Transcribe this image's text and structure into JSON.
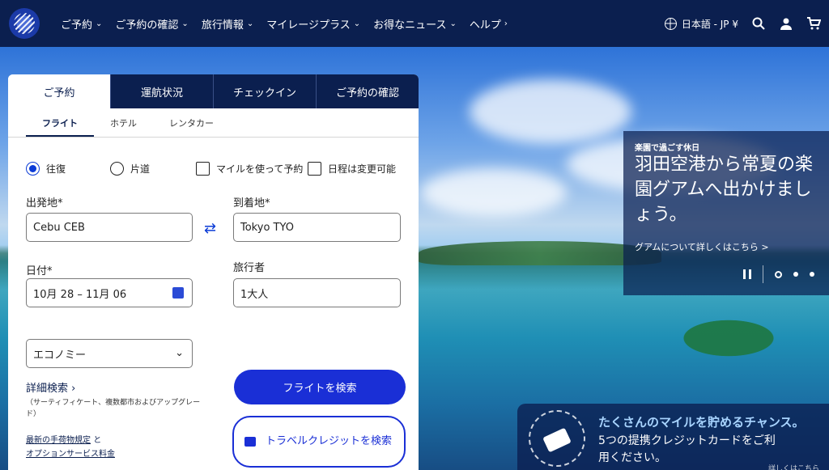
{
  "header": {
    "logo_icon": "globe-logo-icon",
    "nav": [
      {
        "label": "ご予約",
        "has_dropdown": true
      },
      {
        "label": "ご予約の確認",
        "has_dropdown": true
      },
      {
        "label": "旅行情報",
        "has_dropdown": true
      },
      {
        "label": "マイレージプラス",
        "has_dropdown": true
      },
      {
        "label": "お得なニュース",
        "has_dropdown": true
      },
      {
        "label": "ヘルプ",
        "has_dropdown": false
      }
    ],
    "language": "日本語 - JP ¥",
    "icons": [
      "globe-icon",
      "search-icon",
      "user-icon",
      "cart-icon"
    ]
  },
  "booking": {
    "main_tabs": [
      "ご予約",
      "運航状況",
      "チェックイン",
      "ご予約の確認"
    ],
    "active_main_tab": 0,
    "sub_tabs": [
      "フライト",
      "ホテル",
      "レンタカー"
    ],
    "active_sub_tab": 0,
    "trip_types": {
      "roundtrip": "往復",
      "oneway": "片道",
      "use_miles": "マイルを使って予約",
      "flexible_dates": "日程は変更可能"
    },
    "from_label": "出発地*",
    "from_value": "Cebu CEB",
    "to_label": "到着地*",
    "to_value": "Tokyo TYO",
    "date_label": "日付*",
    "date_value": "10月 28 – 11月 06",
    "travelers_label": "旅行者",
    "travelers_value": "1大人",
    "cabin_value": "エコノミー",
    "advanced_search": "詳細検索",
    "advanced_note": "（サーティフィケート、複数都市およびアップグレード）",
    "link_baggage": "最新の手荷物規定",
    "link_and": "と",
    "link_options": "オプションサービス料金",
    "search_button": "フライトを検索",
    "credit_button": "トラベルクレジットを検索"
  },
  "promo": {
    "kicker": "楽園で過ごす休日",
    "title": "羽田空港から常夏の楽園グアムへ出かけましょう。",
    "link": "グアムについて詳しくはこちら",
    "link_chevron": ">"
  },
  "cc_promo": {
    "title": "たくさんのマイルを貯めるチャンス。",
    "text": "5つの提携クレジットカードをご利用ください。",
    "more": "詳しくはこちら"
  },
  "colors": {
    "navy": "#0b1f4f",
    "primary_blue": "#1a2fd6"
  }
}
